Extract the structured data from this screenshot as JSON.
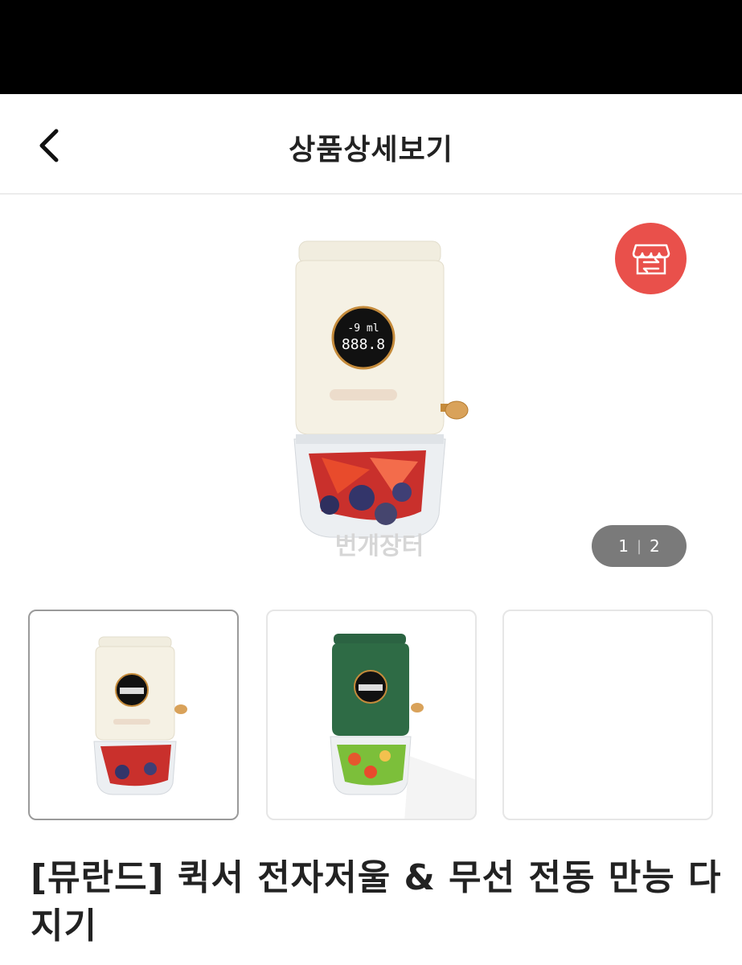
{
  "header": {
    "title": "상품상세보기",
    "back_icon": "chevron-left-icon"
  },
  "gallery": {
    "current_page": "1",
    "total_pages": "2",
    "separator": "|",
    "store_icon": "storefront-swap-icon",
    "store_button_color": "#e9504b",
    "watermark": "번개장터",
    "display": {
      "top_value": "-9  ml",
      "main_value": "888.8"
    },
    "thumbnails": [
      {
        "variant": "cream",
        "selected": true
      },
      {
        "variant": "green",
        "selected": false
      },
      {
        "variant": "empty",
        "selected": false
      }
    ]
  },
  "product": {
    "title": "[뮤란드] 퀵서 전자저울 & 무선 전동 만능 다지기"
  },
  "colors": {
    "accent_red": "#e9504b",
    "cream": "#f3efe2",
    "green": "#2e6b45",
    "pager_bg": "#7a7a7a"
  }
}
